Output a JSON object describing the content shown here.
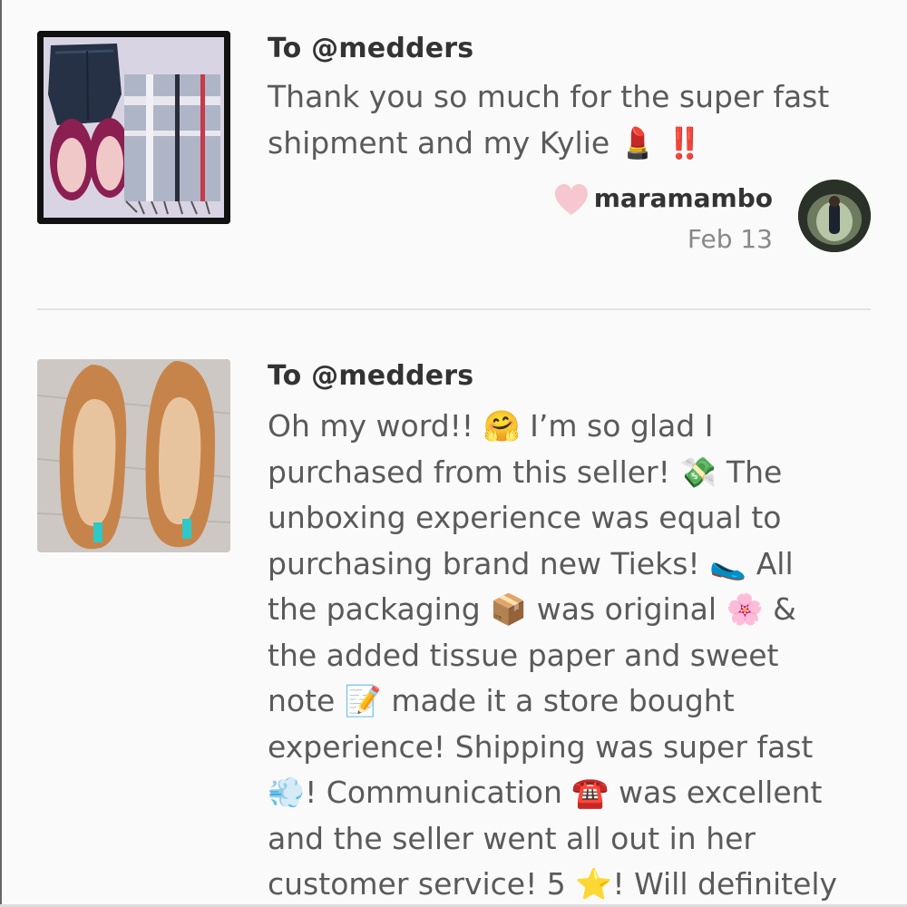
{
  "reviews": [
    {
      "to": "To @medders",
      "text": "Thank you so much for the super fast\nshipment and my Kylie 💄 ‼️",
      "reviewer": "maramambo",
      "date": "Feb 13",
      "photo": "jeans-flats-scarf-photo"
    },
    {
      "to": "To @medders",
      "text": "Oh my word!! 🤗 I’m so glad I\npurchased from this seller! 💸 The\nunboxing experience was equal to\npurchasing brand new Tieks! 🥿 All\nthe packaging 📦 was original 🌸 &\nthe added tissue paper and sweet\nnote 📝 made it a store bought\nexperience! Shipping was super fast\n💨! Communication ☎️ was excellent\nand the seller went all out in her\ncustomer service! 5 ⭐️! Will definitely",
      "photo": "tan-ballet-flats-photo"
    }
  ],
  "colors": {
    "heart": "#f6c7cf",
    "divider": "#e3e1e3",
    "username": "#333333",
    "date": "#888888"
  }
}
